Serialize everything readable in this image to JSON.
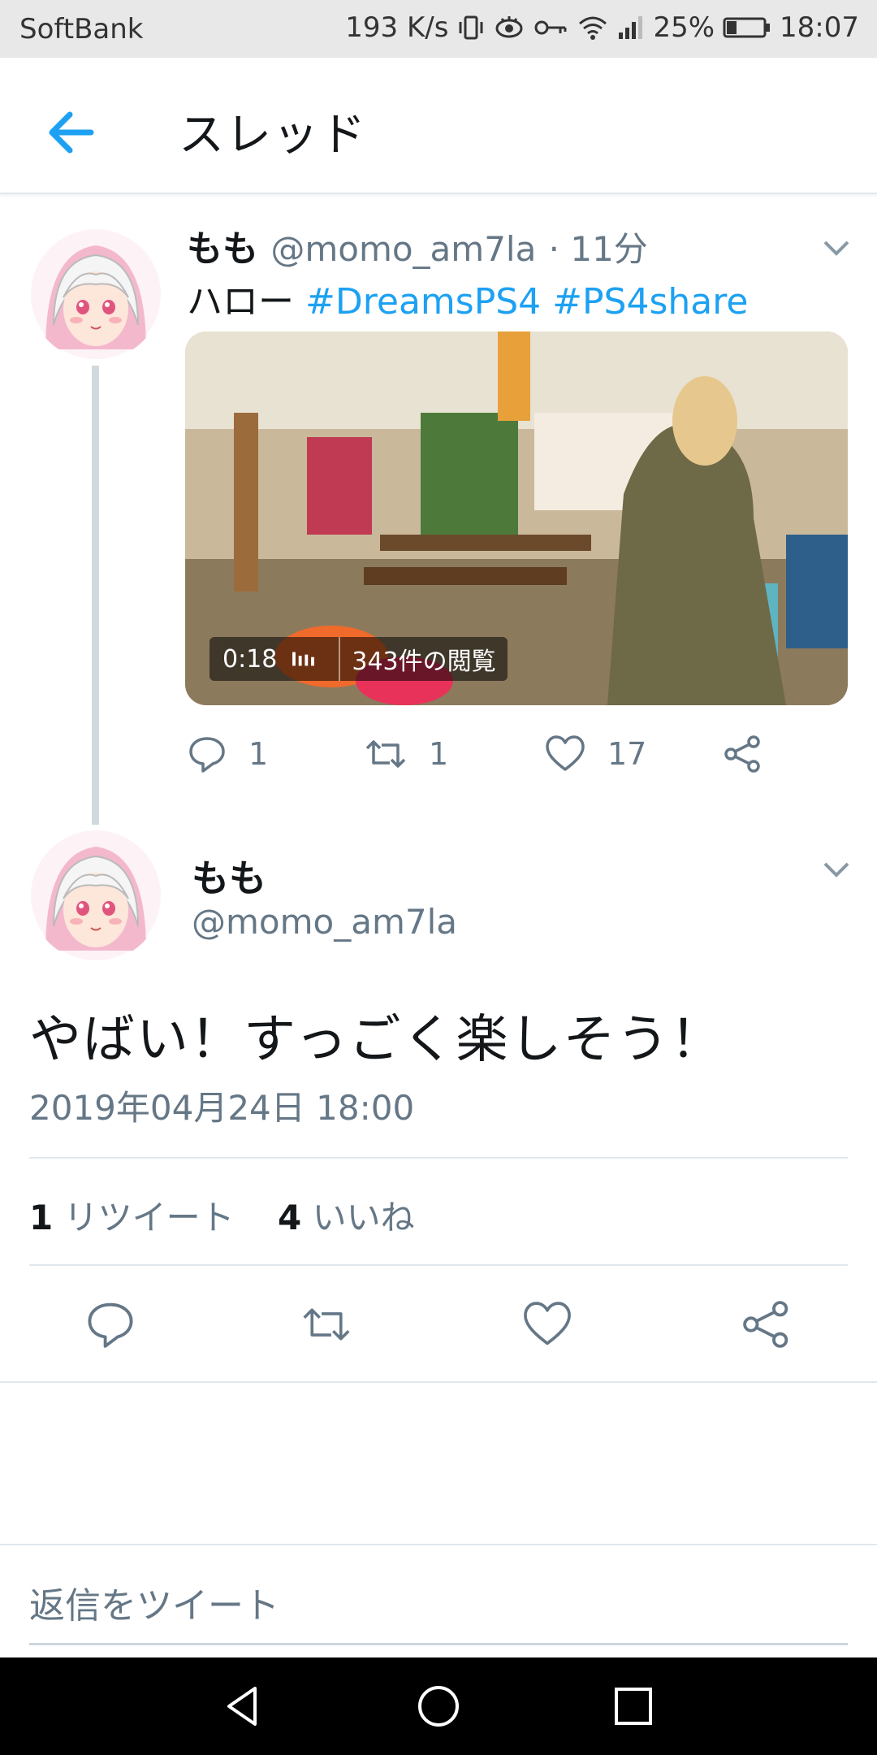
{
  "status_bar": {
    "carrier": "SoftBank",
    "net_speed": "193 K/s",
    "battery": "25%",
    "time": "18:07",
    "icons": [
      "vibrate-icon",
      "eye-icon",
      "vpn-key-icon",
      "wifi-icon",
      "signal-icon",
      "battery-icon"
    ]
  },
  "header": {
    "title": "スレッド"
  },
  "thread_tweet": {
    "name": "もも",
    "handle": "@momo_am7la",
    "time": "· 11分",
    "text": "ハロー ",
    "hashtags": [
      "#DreamsPS4",
      "#PS4share"
    ],
    "media": {
      "duration": "0:18",
      "views": "343件の閲覧"
    },
    "replies": "1",
    "retweets": "1",
    "likes": "17"
  },
  "main_tweet": {
    "name": "もも",
    "handle": "@momo_am7la",
    "text": "やばい！すっごく楽しそう！",
    "timestamp": "2019年04月24日 18:00",
    "retweet_count": "1",
    "retweet_label": "リツイート",
    "like_count": "4",
    "like_label": "いいね"
  },
  "reply_box": {
    "placeholder": "返信をツイート"
  },
  "colors": {
    "accent": "#1da1f2",
    "secondary_text": "#657786",
    "primary_text": "#14171a",
    "divider": "#e1e8ed"
  }
}
